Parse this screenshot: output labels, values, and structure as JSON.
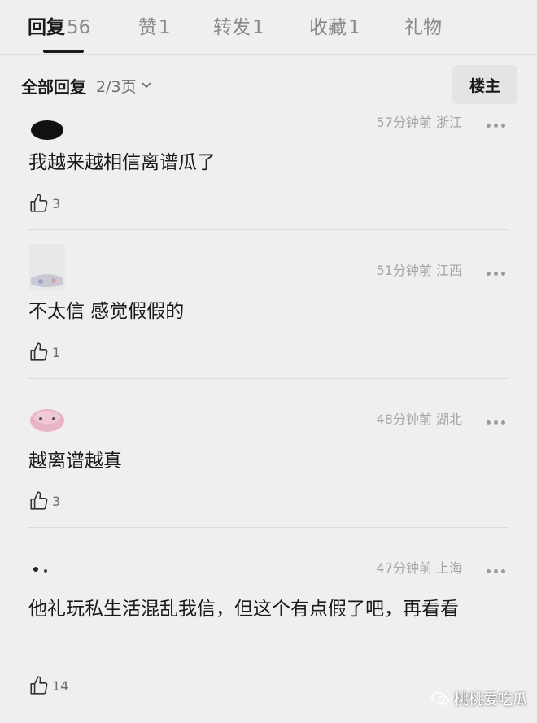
{
  "tabs": [
    {
      "label": "回复",
      "count": "56"
    },
    {
      "label": "赞",
      "count": "1"
    },
    {
      "label": "转发",
      "count": "1"
    },
    {
      "label": "收藏",
      "count": "1"
    },
    {
      "label": "礼物",
      "count": ""
    }
  ],
  "filter": {
    "label": "全部回复",
    "page": "2/3页"
  },
  "author_button": "楼主",
  "comments": [
    {
      "meta": "57分钟前 浙江",
      "text": "我越来越相信离谱瓜了",
      "likes": "3"
    },
    {
      "meta": "51分钟前 江西",
      "text": "不太信  感觉假假的",
      "likes": "1"
    },
    {
      "meta": "48分钟前 湖北",
      "text": "越离谱越真",
      "likes": "3"
    },
    {
      "meta": "47分钟前 上海",
      "text": "他礼玩私生活混乱我信，但这个有点假了吧，再看看",
      "likes": "14"
    }
  ],
  "watermark": "桃桃爱吃瓜"
}
